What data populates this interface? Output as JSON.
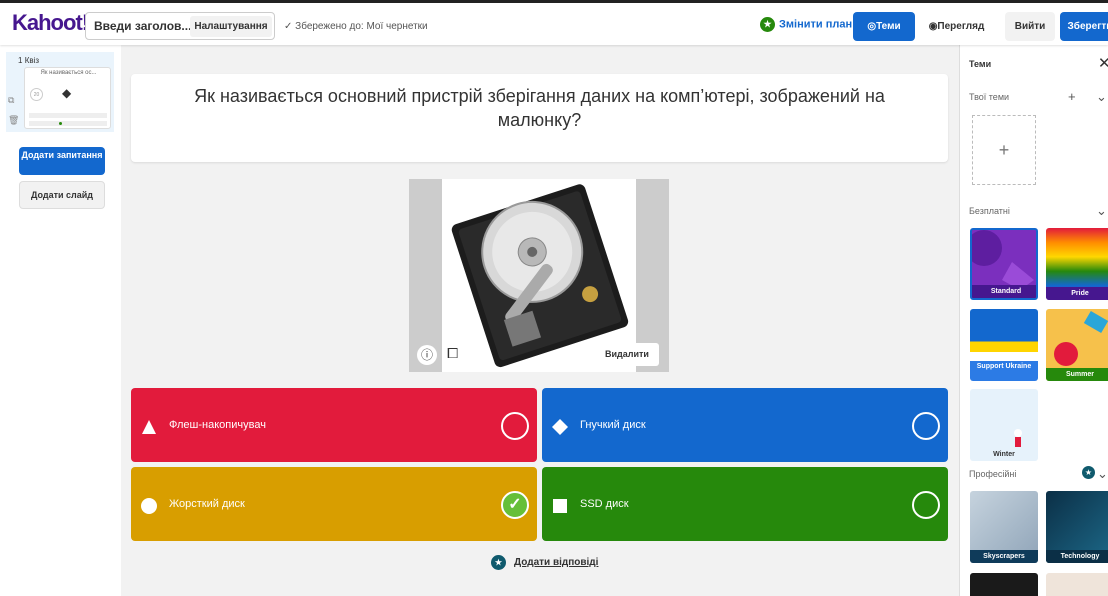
{
  "app": {
    "logo": "Kahoot!"
  },
  "header": {
    "title": "Введи заголов...",
    "settings_label": "Налаштування",
    "saved_status": "✓ Збережено до: Мої чернетки",
    "change_plan": "Змінити план",
    "themes": "Теми",
    "preview": "Перегляд",
    "exit": "Вийти",
    "save": "Зберегти"
  },
  "sidebar": {
    "slide_number": "1",
    "slide_type": "Квіз",
    "slide_preview_text": "Як називається ос...",
    "slide_preview_timer": "20",
    "add_question": "Додати запитання",
    "add_slide": "Додати слайд"
  },
  "question": {
    "text": "Як називається основний пристрій зберігання даних на комп’ютері, зображений на малюнку?"
  },
  "media": {
    "delete_label": "Видалити"
  },
  "answers": [
    {
      "text": "Флеш-накопичувач",
      "color": "#e21b3c",
      "shape": "triangle",
      "correct": false
    },
    {
      "text": "Гнучкий диск",
      "color": "#1368ce",
      "shape": "diamond",
      "correct": false
    },
    {
      "text": "Жорсткий диск",
      "color": "#d89e00",
      "shape": "circle",
      "correct": true
    },
    {
      "text": "SSD диск",
      "color": "#26890c",
      "shape": "square",
      "correct": false
    }
  ],
  "add_answers": "Додати відповіді",
  "themes_panel": {
    "title": "Теми",
    "your_themes": "Твої теми",
    "free": "Безплатні",
    "professional": "Професійні",
    "tiles": [
      {
        "name": "Standard"
      },
      {
        "name": "Pride"
      },
      {
        "name": "Support Ukraine"
      },
      {
        "name": "Summer"
      },
      {
        "name": "Winter"
      },
      {
        "name": "Skyscrapers"
      },
      {
        "name": "Technology"
      }
    ]
  }
}
